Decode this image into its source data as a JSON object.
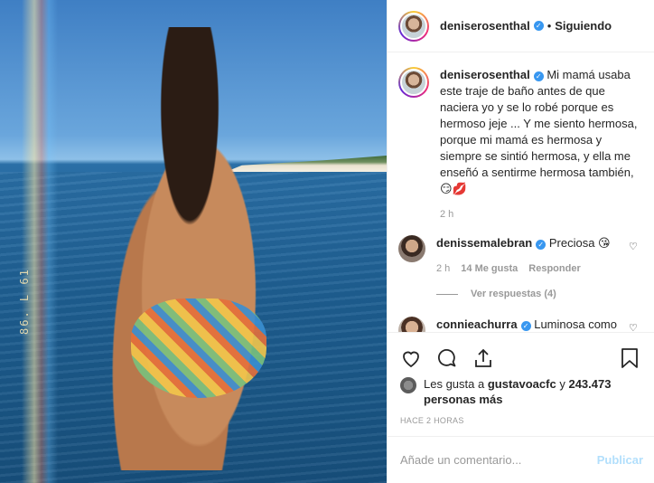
{
  "post": {
    "username": "deniserosenthal",
    "follow_status": "Siguiendo",
    "dot": "•",
    "photo_stamp": "86. L 61"
  },
  "caption": {
    "username": "deniserosenthal",
    "text": "Mi mamá usaba este traje de baño antes de que naciera yo y se lo robé porque es hermoso jeje ... Y me siento hermosa, porque mi mamá es hermosa y siempre se sintió hermosa, y ella me enseñó a sentirme hermosa también, 😏💋",
    "time": "2 h"
  },
  "comments": [
    {
      "username": "denissemalebran",
      "text": "Preciosa 😘",
      "time": "2 h",
      "likes": "14 Me gusta",
      "reply": "Responder",
      "view_replies": "Ver respuestas (4)"
    },
    {
      "username": "connieachurra",
      "text": "Luminosa como un 🌞"
    }
  ],
  "likes": {
    "text": "Les gusta a",
    "user": "gustavoacfc",
    "and": "y",
    "others": "243.473 personas más"
  },
  "timestamp": "HACE 2 HORAS",
  "add_comment": {
    "placeholder": "Añade un comentario...",
    "publish": "Publicar"
  }
}
